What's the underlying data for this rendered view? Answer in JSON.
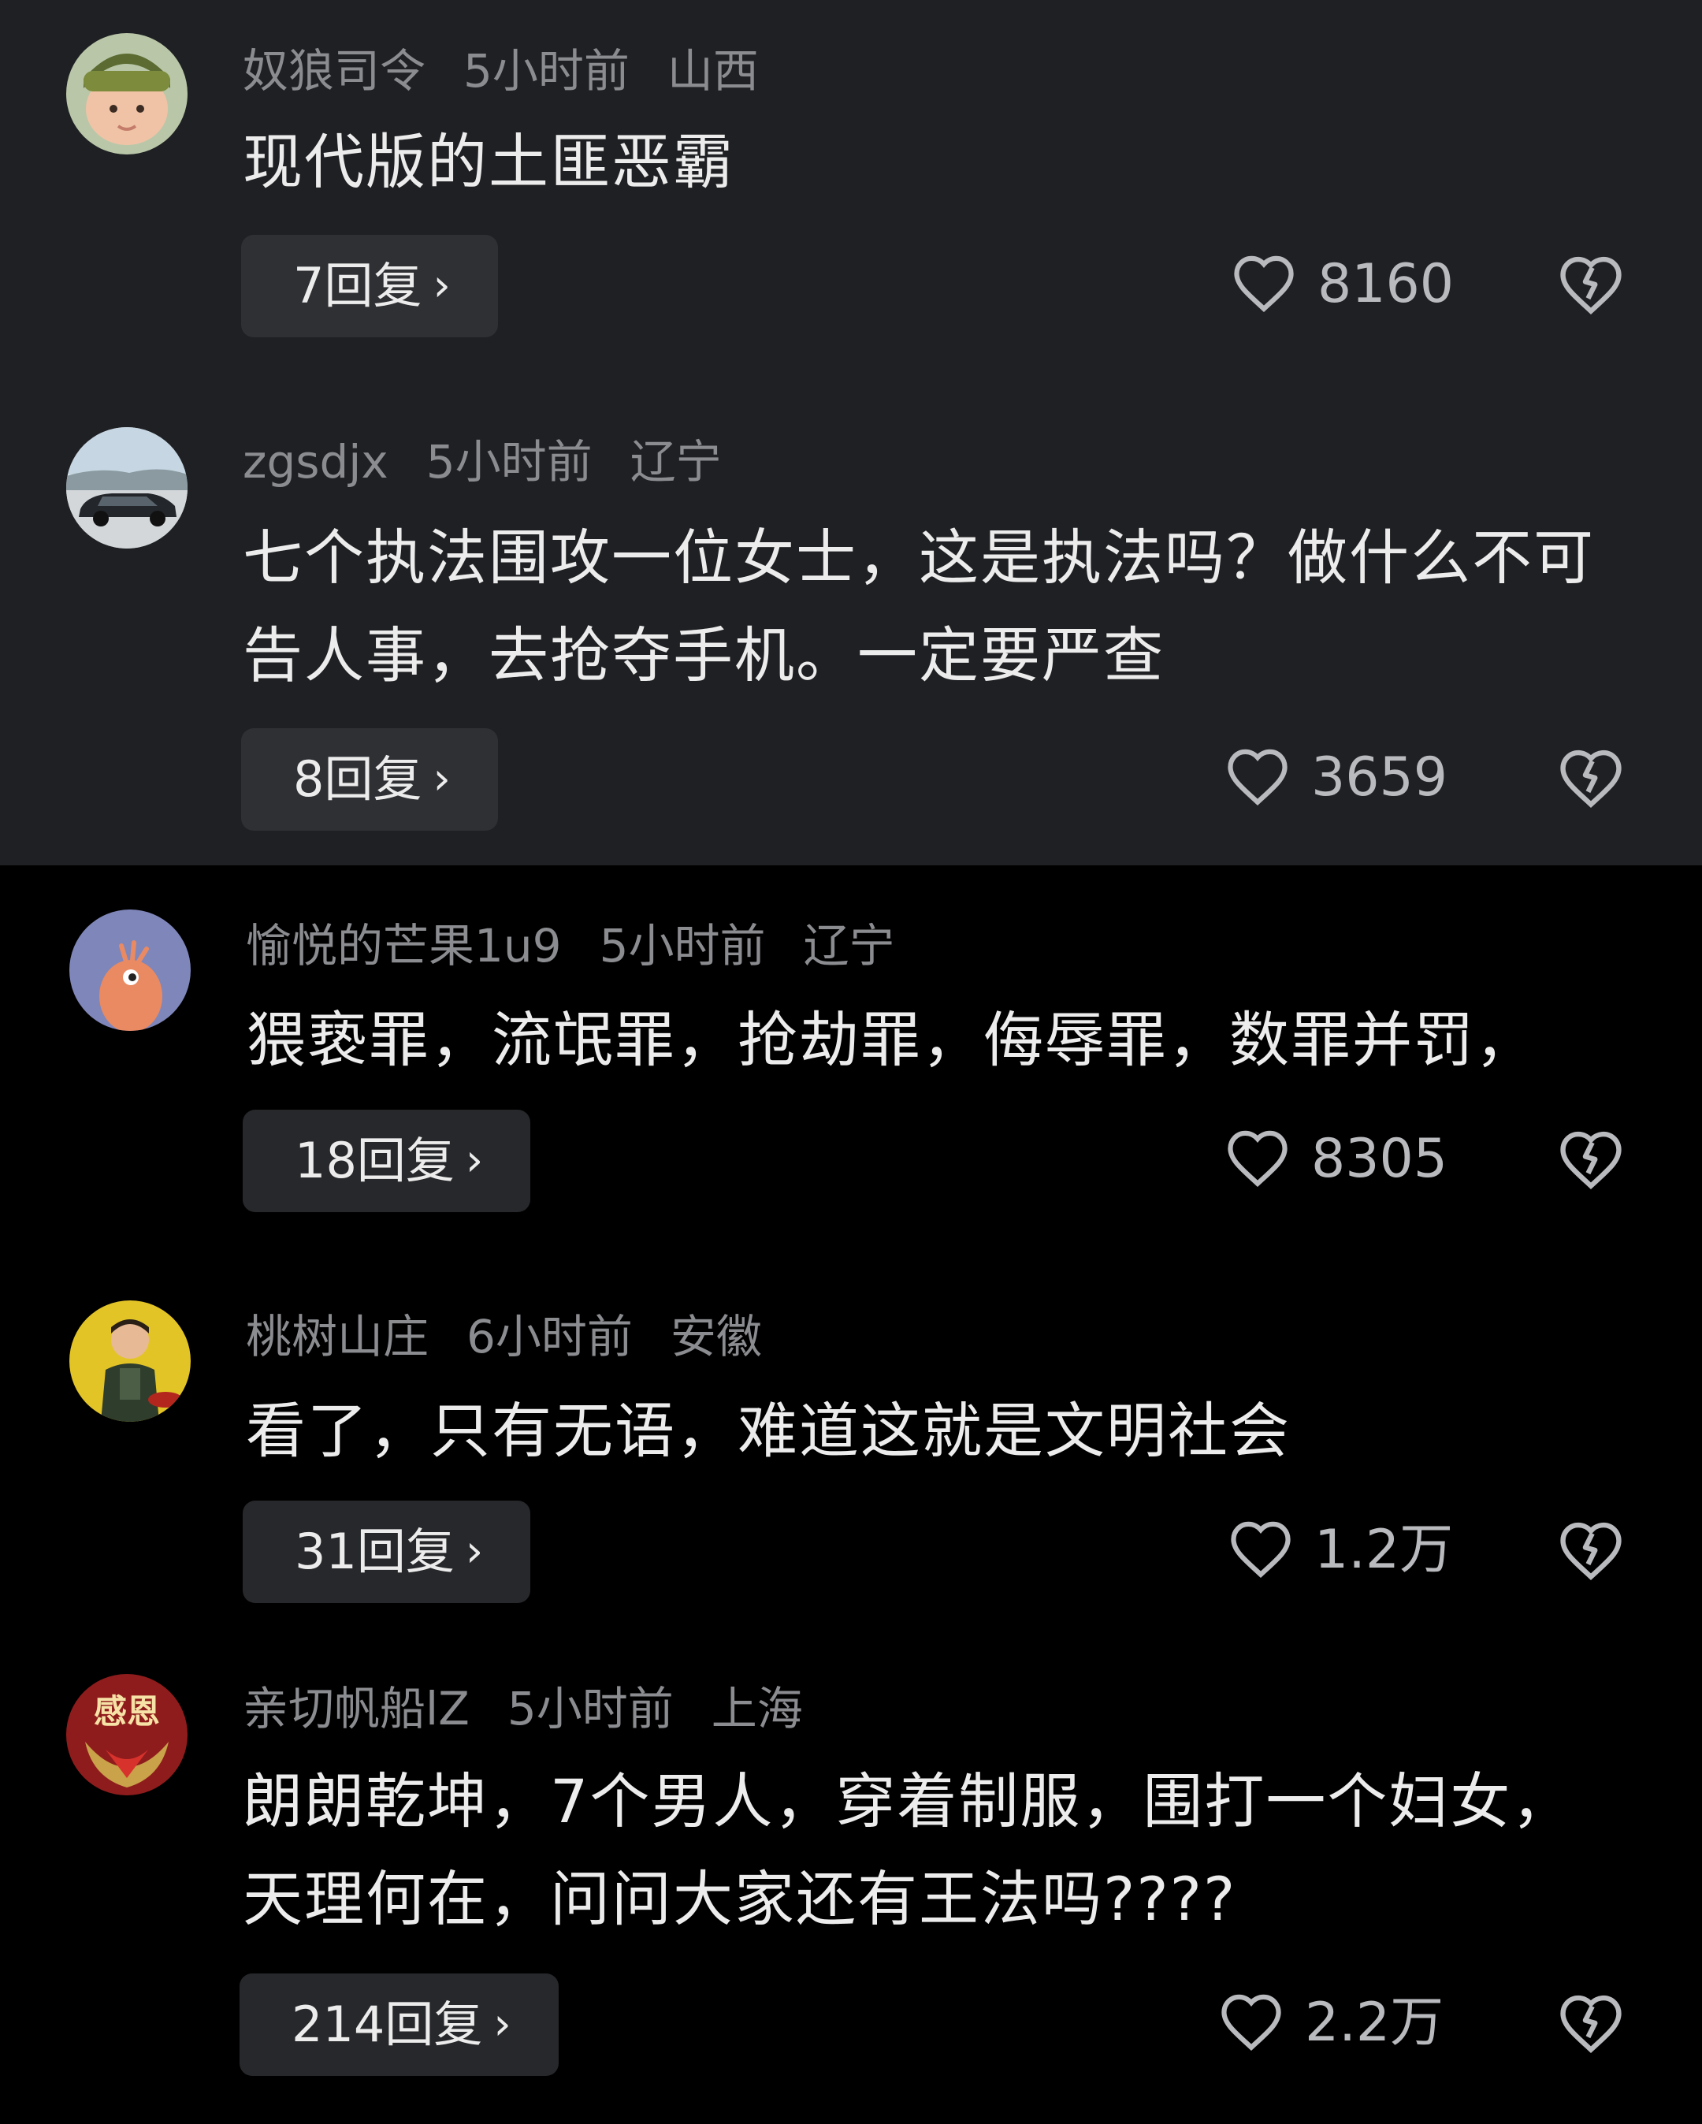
{
  "comments": [
    {
      "username": "奴狼司令",
      "time": "5小时前",
      "location": "山西",
      "text": "现代版的土匪恶霸",
      "reply_label": "7回复",
      "likes": "8160",
      "avatar_icon": "baby-avatar"
    },
    {
      "username": "zgsdjx",
      "time": "5小时前",
      "location": "辽宁",
      "text": "七个执法围攻一位女士，这是执法吗？做什么不可告人事，去抢夺手机。一定要严查",
      "reply_label": "8回复",
      "likes": "3659",
      "avatar_icon": "car-avatar"
    },
    {
      "username": "愉悦的芒果1u9",
      "time": "5小时前",
      "location": "辽宁",
      "text": "猥亵罪，流氓罪，抢劫罪，侮辱罪，数罪并罚，",
      "reply_label": "18回复",
      "likes": "8305",
      "avatar_icon": "mango-bird-avatar"
    },
    {
      "username": "桃树山庄",
      "time": "6小时前",
      "location": "安徽",
      "text": "看了，只有无语，难道这就是文明社会",
      "reply_label": "31回复",
      "likes": "1.2万",
      "avatar_icon": "child-avatar"
    },
    {
      "username": "亲切帆船lZ",
      "time": "5小时前",
      "location": "上海",
      "text": "朗朗乾坤，7个男人，穿着制服，围打一个妇女，天理何在，问问大家还有王法吗????",
      "reply_label": "214回复",
      "likes": "2.2万",
      "avatar_icon": "gratitude-avatar",
      "avatar_text": "感恩"
    }
  ],
  "icons": {
    "chevron": "chevron-right-icon",
    "like": "heart-outline-icon",
    "dislike": "broken-heart-icon"
  },
  "colors": {
    "top_background": "#1f2023",
    "bottom_background": "#000000",
    "meta_text": "#8b8c90",
    "body_text": "#ececec",
    "button_background": "#2f3034"
  }
}
